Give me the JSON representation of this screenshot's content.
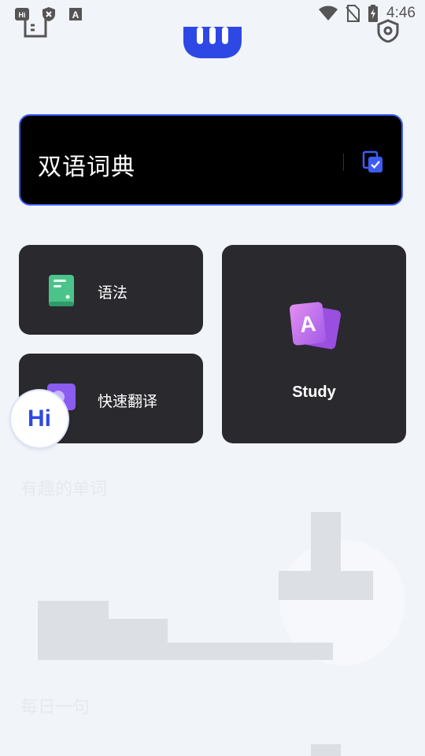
{
  "status_bar": {
    "time": "4:46",
    "left_icons": [
      "hi-app-icon",
      "shield-x-icon",
      "font-a-icon"
    ],
    "right_icons": [
      "wifi-icon",
      "no-sim-icon",
      "battery-charging-icon"
    ]
  },
  "header": {
    "left_icon": "book-icon",
    "logo": "w-logo-icon",
    "right_icon": "shield-settings-icon"
  },
  "dictionary": {
    "title": "双语词典",
    "clipboard_icon": "clipboard-check-icon"
  },
  "tiles": {
    "grammar": {
      "label": "语法",
      "icon": "grammar-doc-icon"
    },
    "translate": {
      "label": "快速翻译",
      "icon": "translate-icon"
    },
    "study": {
      "label": "Study",
      "icon": "flashcard-a-icon"
    }
  },
  "fab": {
    "label": "Hi"
  },
  "sections": {
    "words_title": "有趣的单词",
    "daily_title": "每日一句"
  },
  "colors": {
    "accent": "#3d5cf5",
    "background": "#f1f4f9",
    "tile_bg": "#29292e",
    "card_bg": "#000000"
  }
}
